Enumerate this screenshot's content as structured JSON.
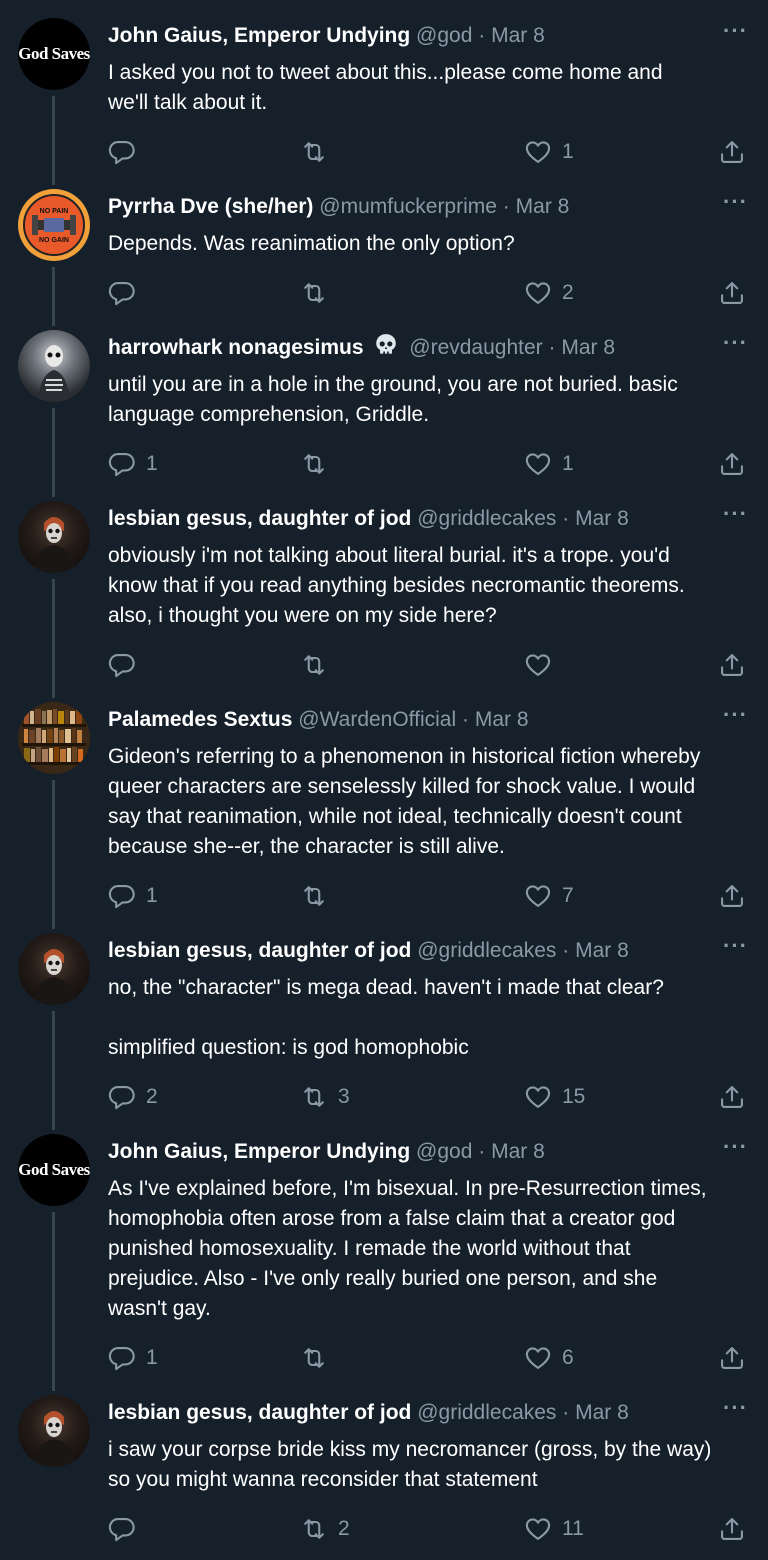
{
  "tweets": [
    {
      "name": "John Gaius, Emperor Undying",
      "handle": "@god",
      "sep": "·",
      "date": "Mar 8",
      "avatar_label": "God Saves",
      "avatar_icon": "god-saves-logo",
      "text": "I asked you not to tweet about this...please come home and\nwe'll talk about it.",
      "replies": "",
      "retweets": "",
      "likes": "1"
    },
    {
      "name": "Pyrrha Dve (she/her)",
      "handle": "@mumfuckerprime",
      "sep": "·",
      "date": "Mar 8",
      "avatar_label_top": "NO PAIN",
      "avatar_label_bottom": "NO GAIN",
      "avatar_icon": "dumbbell-icon",
      "text": "Depends. Was reanimation the only option?",
      "replies": "",
      "retweets": "",
      "likes": "2"
    },
    {
      "name": "harrowhark nonagesimus",
      "name_icon": "skull-emoji",
      "handle": "@revdaughter",
      "sep": "·",
      "date": "Mar 8",
      "avatar_icon": "skeleton-figure",
      "text": "until you are in a hole in the ground, you are not buried. basic\nlanguage comprehension, Griddle.",
      "replies": "1",
      "retweets": "",
      "likes": "1"
    },
    {
      "name": "lesbian gesus, daughter of jod",
      "handle": "@griddlecakes",
      "sep": "·",
      "date": "Mar 8",
      "avatar_icon": "painted-face-figure",
      "text": "obviously i'm not talking about literal burial. it's a trope. you'd\nknow that if you read anything besides necromantic theorems.\nalso, i thought you were on my side here?",
      "replies": "",
      "retweets": "",
      "likes": ""
    },
    {
      "name": "Palamedes Sextus",
      "handle": "@WardenOfficial",
      "sep": "·",
      "date": "Mar 8",
      "avatar_icon": "bookshelf",
      "text": "Gideon's referring to a phenomenon in historical fiction whereby\nqueer characters are senselessly killed for shock value. I would\nsay that reanimation, while not ideal, technically doesn't count\nbecause she--er, the character is still alive.",
      "replies": "1",
      "retweets": "",
      "likes": "7"
    },
    {
      "name": "lesbian gesus, daughter of jod",
      "handle": "@griddlecakes",
      "sep": "·",
      "date": "Mar 8",
      "avatar_icon": "painted-face-figure",
      "text": "no, the \"character\" is mega dead. haven't i made that clear?\n\nsimplified question: is god homophobic",
      "replies": "2",
      "retweets": "3",
      "likes": "15"
    },
    {
      "name": "John Gaius, Emperor Undying",
      "handle": "@god",
      "sep": "·",
      "date": "Mar 8",
      "avatar_label": "God Saves",
      "avatar_icon": "god-saves-logo",
      "text": "As I've explained before, I'm bisexual. In pre-Resurrection times,\nhomophobia often arose from a false claim that a creator god\npunished homosexuality. I remade the world without that\nprejudice. Also - I've only really buried one person, and she\nwasn't gay.",
      "replies": "1",
      "retweets": "",
      "likes": "6"
    },
    {
      "name": "lesbian gesus, daughter of jod",
      "handle": "@griddlecakes",
      "sep": "·",
      "date": "Mar 8",
      "avatar_icon": "painted-face-figure",
      "text": "i saw your corpse bride kiss my necromancer (gross, by the way)\nso you might wanna reconsider that statement",
      "replies": "",
      "retweets": "2",
      "likes": "11"
    }
  ],
  "colors": {
    "background": "#15202b",
    "muted": "#8b98a5",
    "thread_line": "#38444d",
    "text": "#ffffff"
  }
}
